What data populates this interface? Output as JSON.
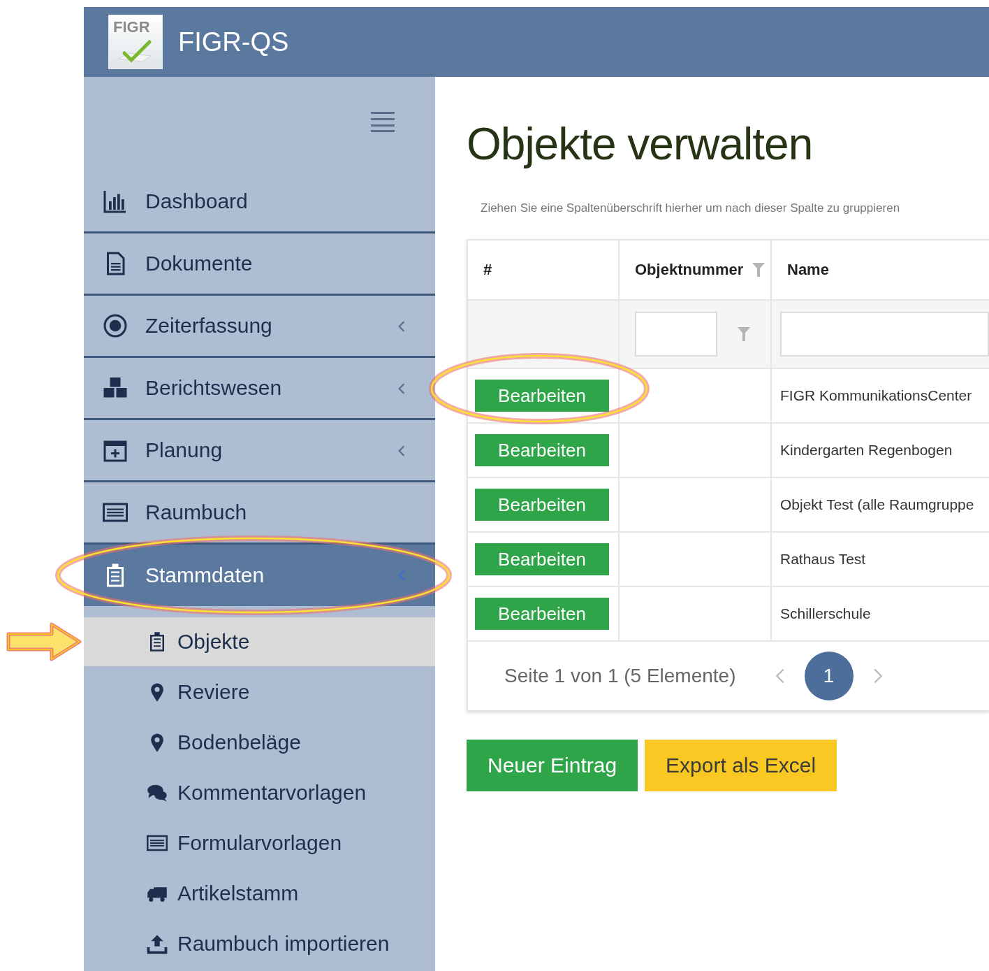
{
  "header": {
    "logo_text": "FIGR",
    "title": "FIGR-QS"
  },
  "sidebar": {
    "items": [
      {
        "label": "Dashboard",
        "has_submenu": false,
        "selected": false
      },
      {
        "label": "Dokumente",
        "has_submenu": false,
        "selected": false
      },
      {
        "label": "Zeiterfassung",
        "has_submenu": true,
        "selected": false
      },
      {
        "label": "Berichtswesen",
        "has_submenu": true,
        "selected": false
      },
      {
        "label": "Planung",
        "has_submenu": true,
        "selected": false
      },
      {
        "label": "Raumbuch",
        "has_submenu": false,
        "selected": false
      },
      {
        "label": "Stammdaten",
        "has_submenu": true,
        "selected": true,
        "expanded": true,
        "highlighted": true,
        "children": [
          {
            "label": "Objekte",
            "selected": true,
            "pointed_at": true
          },
          {
            "label": "Reviere",
            "selected": false
          },
          {
            "label": "Bodenbeläge",
            "selected": false
          },
          {
            "label": "Kommentarvorlagen",
            "selected": false
          },
          {
            "label": "Formularvorlagen",
            "selected": false
          },
          {
            "label": "Artikelstamm",
            "selected": false
          },
          {
            "label": "Raumbuch importieren",
            "selected": false
          }
        ]
      }
    ]
  },
  "page": {
    "title": "Objekte verwalten",
    "group_hint": "Ziehen Sie eine Spaltenüberschrift hierher um nach dieser Spalte zu gruppieren",
    "table": {
      "columns": [
        {
          "label": "#"
        },
        {
          "label": "Objektnummer",
          "filter": true,
          "filter_field": true
        },
        {
          "label": "Name",
          "filter_field": true
        }
      ],
      "rows": [
        {
          "button": "Bearbeiten",
          "name": "FIGR KommunikationsCenter",
          "highlighted": true
        },
        {
          "button": "Bearbeiten",
          "name": "Kindergarten Regenbogen"
        },
        {
          "button": "Bearbeiten",
          "name": "Objekt Test (alle Raumgruppe"
        },
        {
          "button": "Bearbeiten",
          "name": "Rathaus Test"
        },
        {
          "button": "Bearbeiten",
          "name": "Schillerschule"
        }
      ],
      "pager": {
        "summary": "Seite 1 von 1 (5 Elemente)",
        "pages": [
          {
            "label": "1",
            "selected": true
          }
        ]
      }
    },
    "buttons": [
      {
        "label": "Neuer Eintrag",
        "kind": "primary"
      },
      {
        "label": "Export als Excel",
        "kind": "warning"
      }
    ]
  }
}
